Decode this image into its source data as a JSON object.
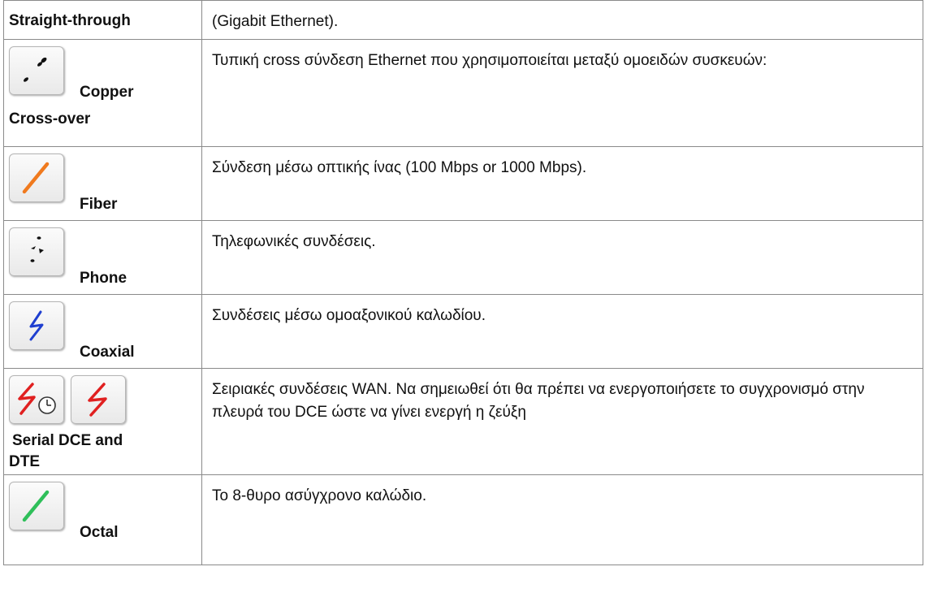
{
  "rows": [
    {
      "name": "Straight-through",
      "desc": "(Gigabit Ethernet)."
    },
    {
      "name_line1": "Copper",
      "name_line2": "Cross-over",
      "desc": "Τυπική cross σύνδεση Ethernet που χρησιμοποιείται μεταξύ ομοειδών συσκευών:",
      "icon": "copper-cross-over-cable-icon"
    },
    {
      "name": "Fiber",
      "desc": "Σύνδεση μέσω οπτικής ίνας (100 Mbps or 1000 Mbps).",
      "icon": "fiber-cable-icon",
      "color": "#f07a1e"
    },
    {
      "name": "Phone",
      "desc": "Τηλεφωνικές συνδέσεις.",
      "icon": "phone-cable-icon"
    },
    {
      "name": "Coaxial",
      "desc": "Συνδέσεις μέσω ομοαξονικού καλωδίου.",
      "icon": "coaxial-cable-icon",
      "color": "#1f3fd0"
    },
    {
      "name_line1": "Serial DCE and",
      "name_line2": "DTE",
      "desc": "Σειριακές συνδέσεις WAN. Να σημειωθεί ότι θα πρέπει να ενεργοποιήσετε το συγχρονισμό στην πλευρά του DCE ώστε να γίνει ενεργή η ζεύξη",
      "icons": [
        "serial-dce-cable-icon",
        "serial-dte-cable-icon"
      ],
      "color": "#e02020"
    },
    {
      "name": "Octal",
      "desc": "Το 8-θυρο ασύγχρονο καλώδιο.",
      "icon": "octal-cable-icon",
      "color": "#2fbf5a"
    }
  ]
}
